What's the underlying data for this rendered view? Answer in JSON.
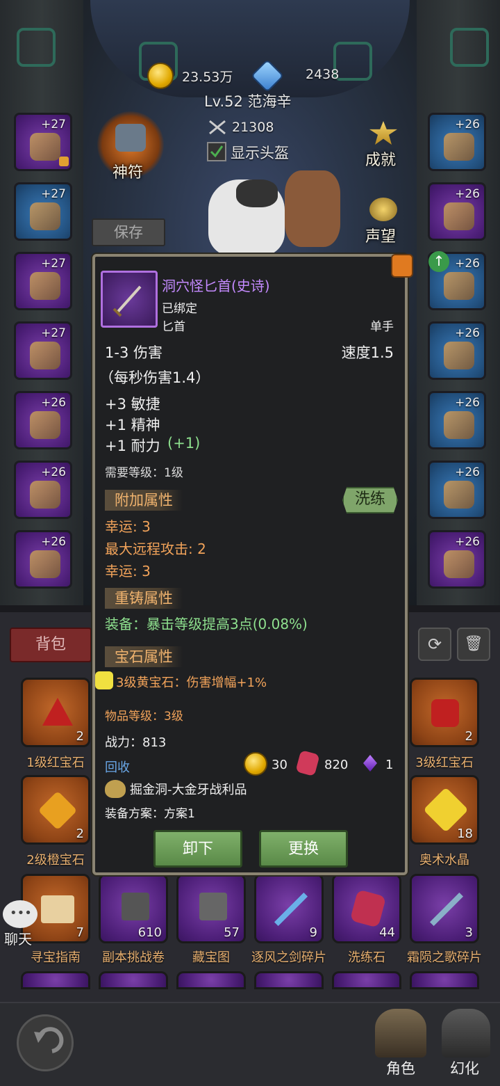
{
  "currency": {
    "gold": "23.53万",
    "diamond": "2438"
  },
  "player": {
    "level_name": "Lv.52 范海辛",
    "power": "21308",
    "show_helmet": "显示头盔"
  },
  "side_buttons": {
    "rune": "神符",
    "save": "保存",
    "achievement": "成就",
    "reputation": "声望"
  },
  "left_slots": [
    "+27",
    "+27",
    "+27",
    "+27",
    "+26",
    "+26",
    "+26"
  ],
  "right_slots": [
    "+26",
    "+26",
    "+26",
    "+26",
    "+26",
    "+26",
    "+26"
  ],
  "item": {
    "name": "洞穴怪匕首(史诗)",
    "bound": "已绑定",
    "type": "匕首",
    "hand": "单手",
    "damage": "1-3 伤害",
    "speed": "速度1.5",
    "dps": "（每秒伤害1.4）",
    "stats": [
      "+3 敏捷",
      "+1 精神",
      "+1 耐力"
    ],
    "stat_bonus": "(+1)",
    "req_level": "需要等级：1级",
    "extra_title": "附加属性",
    "reroll": "洗练",
    "extra": [
      "幸运: 3",
      "最大远程攻击: 2",
      "幸运: 3"
    ],
    "reforge_title": "重铸属性",
    "reforge": "装备：暴击等级提高3点(0.08%)",
    "gem_title": "宝石属性",
    "gem": "3级黄宝石：伤害增幅+1%",
    "item_level": "物品等级：3级",
    "power": "战力：813",
    "recycle": "回收",
    "recycle_gold": "30",
    "recycle_stone": "820",
    "recycle_crystal": "1",
    "source": "掘金洞-大金牙战利品",
    "plan": "装备方案：方案1",
    "unequip": "卸下",
    "replace": "更换"
  },
  "inventory": {
    "tab": "背包",
    "rows": [
      [
        {
          "name": "1级红宝石",
          "count": "2"
        },
        {
          "name": "3级红宝石",
          "count": "2"
        }
      ],
      [
        {
          "name": "2级橙宝石",
          "count": "2"
        },
        {
          "name": "奥术水晶",
          "count": "18"
        }
      ]
    ],
    "row3": [
      {
        "name": "寻宝指南",
        "count": "7"
      },
      {
        "name": "副本挑战卷",
        "count": "610"
      },
      {
        "name": "藏宝图",
        "count": "57"
      },
      {
        "name": "逐风之剑碎片",
        "count": "9"
      },
      {
        "name": "洗练石",
        "count": "44"
      },
      {
        "name": "霜陨之歌碎片",
        "count": "3"
      }
    ]
  },
  "chat": "聊天",
  "nav": {
    "character": "角色",
    "illusion": "幻化"
  }
}
